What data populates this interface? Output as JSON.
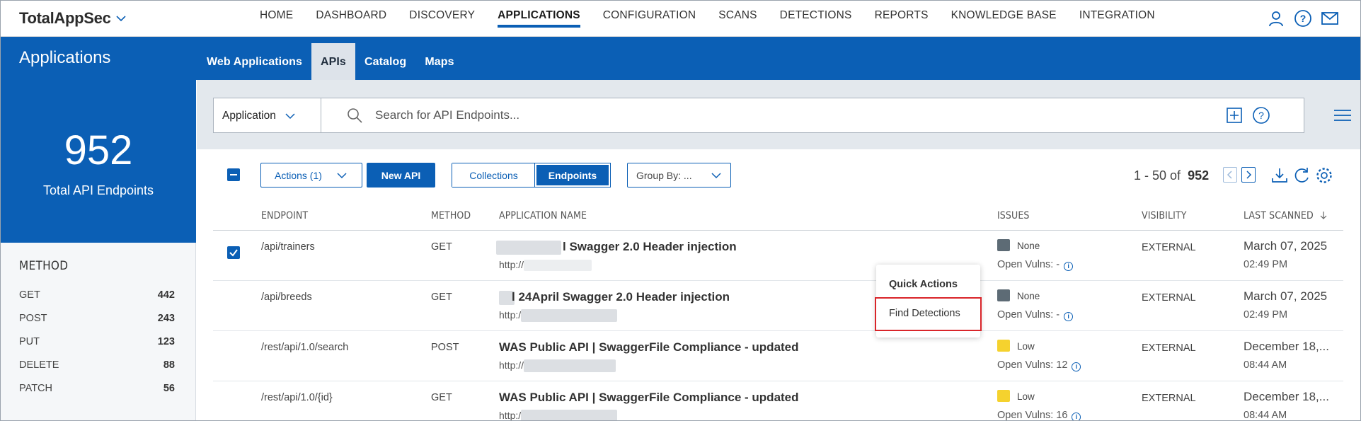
{
  "brand": {
    "name": "TotalAppSec"
  },
  "nav": {
    "items": [
      "HOME",
      "DASHBOARD",
      "DISCOVERY",
      "APPLICATIONS",
      "CONFIGURATION",
      "SCANS",
      "DETECTIONS",
      "REPORTS",
      "KNOWLEDGE BASE",
      "INTEGRATION"
    ],
    "active": "APPLICATIONS"
  },
  "header": {
    "title": "Applications",
    "tabs": [
      "Web Applications",
      "APIs",
      "Catalog",
      "Maps"
    ],
    "active_tab": "APIs"
  },
  "summary": {
    "count": "952",
    "label": "Total API Endpoints"
  },
  "method_filter": {
    "heading": "METHOD",
    "items": [
      {
        "label": "GET",
        "count": "442"
      },
      {
        "label": "POST",
        "count": "243"
      },
      {
        "label": "PUT",
        "count": "123"
      },
      {
        "label": "DELETE",
        "count": "88"
      },
      {
        "label": "PATCH",
        "count": "56"
      }
    ]
  },
  "search": {
    "selector": "Application",
    "placeholder": "Search for API Endpoints..."
  },
  "toolbar": {
    "actions_label": "Actions (1)",
    "new_label": "New API",
    "view_collections": "Collections",
    "view_endpoints": "Endpoints",
    "groupby_label": "Group By: ...",
    "pager_range": "1 - 50 of",
    "pager_total": "952"
  },
  "table": {
    "headers": [
      "ENDPOINT",
      "METHOD",
      "APPLICATION NAME",
      "ISSUES",
      "VISIBILITY",
      "LAST SCANNED"
    ],
    "rows": [
      {
        "checked": true,
        "endpoint": "/api/trainers",
        "method": "GET",
        "app_name": "l Swagger 2.0 Header injection",
        "url": "http://",
        "issue": "None",
        "sev_color": "#5d6b75",
        "vulns": "Open Vulns: -",
        "visibility": "EXTERNAL",
        "date": "March 07, 2025",
        "time": "02:49 PM"
      },
      {
        "checked": false,
        "endpoint": "/api/breeds",
        "method": "GET",
        "app_name": "l 24April Swagger 2.0 Header injection",
        "url": "http:/",
        "issue": "None",
        "sev_color": "#5d6b75",
        "vulns": "Open Vulns: -",
        "visibility": "EXTERNAL",
        "date": "March 07, 2025",
        "time": "02:49 PM"
      },
      {
        "checked": false,
        "endpoint": "/rest/api/1.0/search",
        "method": "POST",
        "app_name": "WAS Public API | SwaggerFile Compliance - updated",
        "url": "http://",
        "issue": "Low",
        "sev_color": "#f5d22e",
        "vulns": "Open Vulns: 12",
        "visibility": "EXTERNAL",
        "date": "December 18,...",
        "time": "08:44 AM"
      },
      {
        "checked": false,
        "endpoint": "/rest/api/1.0/{id}",
        "method": "GET",
        "app_name": "WAS Public API | SwaggerFile Compliance - updated",
        "url": "http:/",
        "issue": "Low",
        "sev_color": "#f5d22e",
        "vulns": "Open Vulns: 16",
        "visibility": "EXTERNAL",
        "date": "December 18,...",
        "time": "08:44 AM"
      }
    ]
  },
  "popover": {
    "title": "Quick Actions",
    "item": "Find Detections"
  },
  "colors": {
    "primary": "#0b5fb5",
    "highlight": "#d9252a"
  }
}
